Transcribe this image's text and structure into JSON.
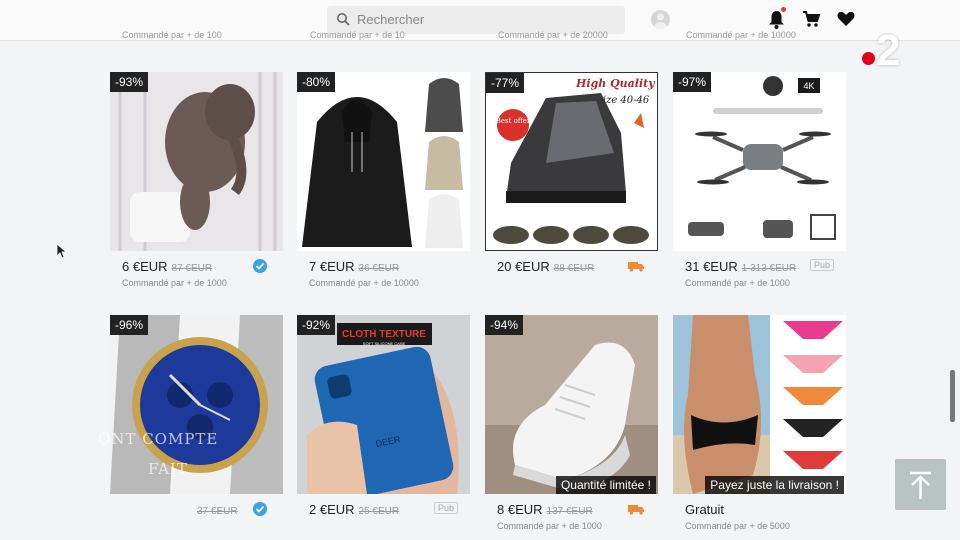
{
  "header": {
    "search_placeholder": "Rechercher",
    "previous_row_ordered": [
      "Commandé par + de 100",
      "Commandé par + de 10",
      "Commandé par + de 20000",
      "Commandé par + de 10000"
    ]
  },
  "channel_logo": {
    "digit": "2"
  },
  "products": [
    {
      "discount": "-93%",
      "price": "6 €EUR",
      "old_price": "87 €EUR",
      "ordered": "Commandé par + de 1000",
      "badge_type": "check"
    },
    {
      "discount": "-80%",
      "price": "7 €EUR",
      "old_price": "36 €EUR",
      "ordered": "Commandé par + de 10000",
      "badge_type": "none"
    },
    {
      "discount": "-77%",
      "price": "20 €EUR",
      "old_price": "88 €EUR",
      "ordered": "",
      "badge_type": "truck",
      "img_text": [
        "High Quality",
        "Size 40-46",
        "Best offer"
      ]
    },
    {
      "discount": "-97%",
      "price": "31 €EUR",
      "old_price": "1 313 €EUR",
      "ordered": "Commandé par + de 1000",
      "badge_type": "pub",
      "pub_label": "Pub",
      "img_text": [
        "4K"
      ]
    },
    {
      "discount": "-96%",
      "price": "",
      "old_price": "37 €EUR",
      "ordered": "",
      "badge_type": "check"
    },
    {
      "discount": "-92%",
      "price": "2 €EUR",
      "old_price": "25 €EUR",
      "ordered": "",
      "badge_type": "pub",
      "pub_label": "Pub",
      "img_text": [
        "CLOTH TEXTURE",
        "SOFT SILICONE CASE",
        "DEER"
      ]
    },
    {
      "discount": "-94%",
      "price": "8 €EUR",
      "old_price": "137 €EUR",
      "ordered": "Commandé par + de 1000",
      "badge_type": "truck",
      "tag": "Quantité limitée !"
    },
    {
      "discount": "",
      "price": "Gratuit",
      "old_price": "",
      "ordered": "Commandé par + de 5000",
      "badge_type": "none",
      "tag": "Payez juste la livraison !"
    }
  ],
  "ghost_caption": [
    "ONT COMPTE",
    "FAIT"
  ]
}
